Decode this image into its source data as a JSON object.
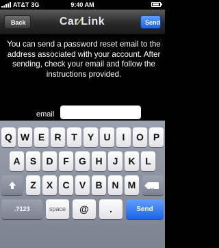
{
  "status": {
    "carrier": "AT&T",
    "network": "3G",
    "time": "9:40 AM"
  },
  "nav": {
    "back_label": "Back",
    "logo_left": "Car",
    "logo_right": "Link",
    "send_label": "Send"
  },
  "content": {
    "message": "You can send a password reset email to the address associated with your account.  After sending, check your email and follow the instructions provided.",
    "email_label": "email",
    "email_value": ""
  },
  "keyboard": {
    "row1": [
      "Q",
      "W",
      "E",
      "R",
      "T",
      "Y",
      "U",
      "I",
      "O",
      "P"
    ],
    "row2": [
      "A",
      "S",
      "D",
      "F",
      "G",
      "H",
      "J",
      "K",
      "L"
    ],
    "row3": [
      "Z",
      "X",
      "C",
      "V",
      "B",
      "N",
      "M"
    ],
    "numbers_label": ".?123",
    "space_label": "space",
    "at_label": "@",
    "dot_label": ".",
    "send_label": "Send"
  },
  "colors": {
    "accent": "#1c63e8",
    "logo_swoosh": "#d7f55a"
  }
}
